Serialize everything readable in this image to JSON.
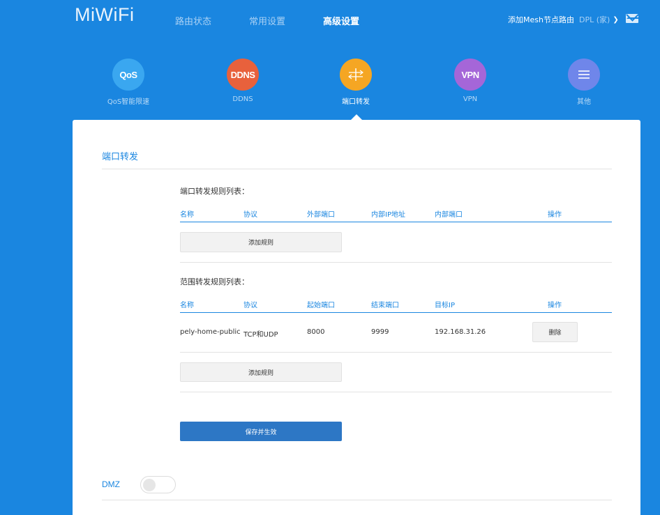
{
  "header": {
    "logo": "MiWiFi",
    "nav": [
      "路由状态",
      "常用设置",
      "高级设置"
    ],
    "active_nav": "高级设置",
    "mesh_link": "添加Mesh节点路由",
    "user": "DPL (家)"
  },
  "features": [
    {
      "icon_text": "QoS",
      "label": "QoS智能限速",
      "icon": "qos-icon",
      "color": "#3aa7f0"
    },
    {
      "icon_text": "DDNS",
      "label": "DDNS",
      "icon": "ddns-icon",
      "color": "#e8613c"
    },
    {
      "icon_text": "",
      "label": "端口转发",
      "icon": "port-forward-icon",
      "color": "#f5a623"
    },
    {
      "icon_text": "VPN",
      "label": "VPN",
      "icon": "vpn-icon",
      "color": "#a566d8"
    },
    {
      "icon_text": "",
      "label": "其他",
      "icon": "menu-icon",
      "color": "#6f86ea"
    }
  ],
  "panel": {
    "title": "端口转发",
    "port_rules": {
      "title": "端口转发规则列表：",
      "headers": [
        "名称",
        "协议",
        "外部端口",
        "内部IP地址",
        "内部端口",
        "操作"
      ],
      "rows": [],
      "add_button": "添加规则"
    },
    "range_rules": {
      "title": "范围转发规则列表：",
      "headers": [
        "名称",
        "协议",
        "起始端口",
        "结束端口",
        "目标IP",
        "操作"
      ],
      "rows": [
        {
          "name": "pely-home-public",
          "protocol": "TCP和UDP",
          "start": "8000",
          "end": "9999",
          "target_ip": "192.168.31.26",
          "action": "删除"
        }
      ],
      "add_button": "添加规则"
    },
    "save_button": "保存并生效",
    "dmz_label": "DMZ",
    "dmz_enabled": false
  }
}
